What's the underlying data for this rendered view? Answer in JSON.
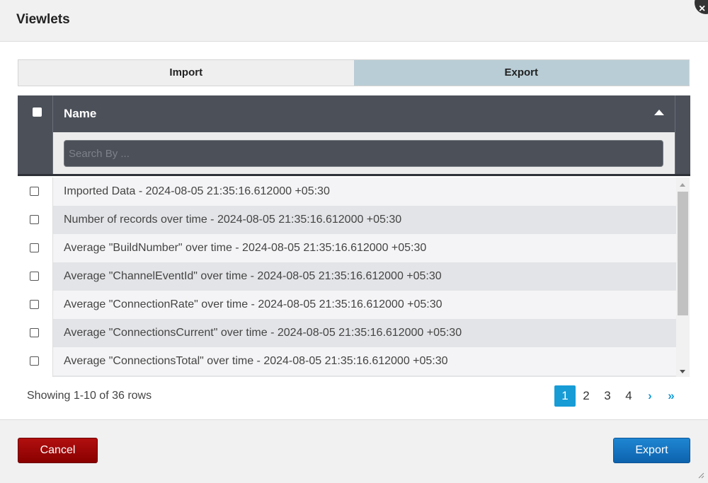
{
  "dialog": {
    "title": "Viewlets",
    "close_icon": "close-icon"
  },
  "tabs": [
    {
      "label": "Import",
      "active": false
    },
    {
      "label": "Export",
      "active": true
    }
  ],
  "table": {
    "column_name": "Name",
    "search_placeholder": "Search By ...",
    "rows": [
      "Imported Data - 2024-08-05 21:35:16.612000 +05:30",
      "Number of records over time - 2024-08-05 21:35:16.612000 +05:30",
      "Average \"BuildNumber\" over time - 2024-08-05 21:35:16.612000 +05:30",
      "Average \"ChannelEventId\" over time - 2024-08-05 21:35:16.612000 +05:30",
      "Average \"ConnectionRate\" over time - 2024-08-05 21:35:16.612000 +05:30",
      "Average \"ConnectionsCurrent\" over time - 2024-08-05 21:35:16.612000 +05:30",
      "Average \"ConnectionsTotal\" over time - 2024-08-05 21:35:16.612000 +05:30"
    ]
  },
  "pagination": {
    "info": "Showing 1-10 of 36 rows",
    "pages": [
      "1",
      "2",
      "3",
      "4"
    ],
    "current_page": "1",
    "next": "›",
    "last": "»"
  },
  "buttons": {
    "cancel": "Cancel",
    "export": "Export"
  },
  "colors": {
    "accent": "#179cd6",
    "active_tab": "#b9cdd6",
    "header_dark": "#4b5059",
    "cancel": "#9e0a0a",
    "export": "#1570c0"
  }
}
